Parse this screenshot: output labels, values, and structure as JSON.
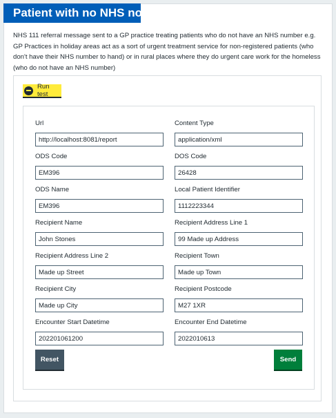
{
  "title": "Patient with no NHS no.",
  "description": "NHS 111 referral message sent to a GP practice treating patients who do not have an NHS number e.g. GP Practices in holiday areas act as a sort of urgent treatment service for non-registered patients (who don't have their NHS number to hand) or in rural places where they do urgent care work for the homeless (who do not have an NHS number)",
  "run_test": {
    "label": "Run test",
    "icon": "minus-circle-icon"
  },
  "form": {
    "url": {
      "label": "Url",
      "value": "http://localhost:8081/report"
    },
    "content_type": {
      "label": "Content Type",
      "value": "application/xml"
    },
    "ods_code": {
      "label": "ODS Code",
      "value": "EM396"
    },
    "dos_code": {
      "label": "DOS Code",
      "value": "26428"
    },
    "ods_name": {
      "label": "ODS Name",
      "value": "EM396"
    },
    "local_patient_id": {
      "label": "Local Patient Identifier",
      "value": "1112223344"
    },
    "recipient_name": {
      "label": "Recipient Name",
      "value": "John Stones"
    },
    "recipient_address_1": {
      "label": "Recipient Address Line 1",
      "value": "99 Made up Address"
    },
    "recipient_address_2": {
      "label": "Recipient Address Line 2",
      "value": "Made up Street"
    },
    "recipient_town": {
      "label": "Recipient Town",
      "value": "Made up Town"
    },
    "recipient_city": {
      "label": "Recipient City",
      "value": "Made up City"
    },
    "recipient_postcode": {
      "label": "Recipient Postcode",
      "value": "M27 1XR"
    },
    "encounter_start": {
      "label": "Encounter Start Datetime",
      "value": "202201061200"
    },
    "encounter_end": {
      "label": "Encounter End Datetime",
      "value": "2022010613"
    }
  },
  "buttons": {
    "reset": "Reset",
    "send": "Send"
  },
  "colors": {
    "header": "#005eb8",
    "run_test": "#ffeb3b",
    "reset": "#425563",
    "send": "#007f3b"
  }
}
